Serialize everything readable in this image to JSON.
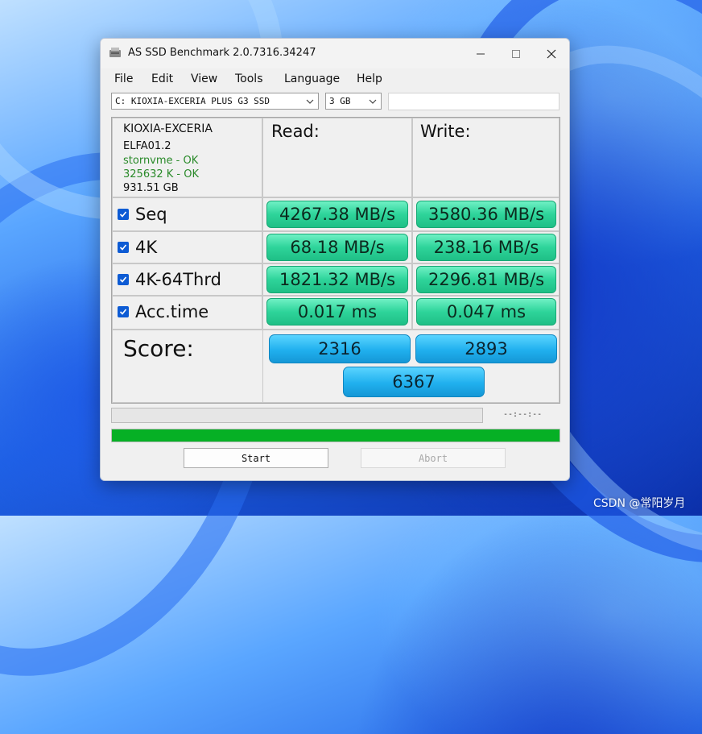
{
  "window": {
    "title": "AS SSD Benchmark 2.0.7316.34247"
  },
  "menu": [
    "File",
    "Edit",
    "View",
    "Tools",
    "Language",
    "Help"
  ],
  "drive_select": {
    "value": "C: KIOXIA-EXCERIA PLUS G3 SSD"
  },
  "size_select": {
    "value": "3 GB"
  },
  "drive_info": {
    "model": "KIOXIA-EXCERIA",
    "firmware": "ELFA01.2",
    "driver": "stornvme - OK",
    "alignment": "325632 K - OK",
    "capacity": "931.51 GB"
  },
  "columns": {
    "read": "Read:",
    "write": "Write:"
  },
  "tests": [
    {
      "label": "Seq",
      "checked": true,
      "read": "4267.38 MB/s",
      "write": "3580.36 MB/s"
    },
    {
      "label": "4K",
      "checked": true,
      "read": "68.18 MB/s",
      "write": "238.16 MB/s"
    },
    {
      "label": "4K-64Thrd",
      "checked": true,
      "read": "1821.32 MB/s",
      "write": "2296.81 MB/s"
    },
    {
      "label": "Acc.time",
      "checked": true,
      "read": "0.017 ms",
      "write": "0.047 ms"
    }
  ],
  "score": {
    "label": "Score:",
    "read": "2316",
    "write": "2893",
    "total": "6367"
  },
  "progress": {
    "time": "--:--:--",
    "overall_fraction": 1.0
  },
  "buttons": {
    "start": "Start",
    "abort": "Abort"
  },
  "watermark": "CSDN @常阳岁月",
  "colors": {
    "value_bar": "#2ed49a",
    "score_bar": "#20b0ee",
    "progress": "#06b025",
    "checkbox": "#0d5bd4",
    "info_ok": "#2a8a2a"
  }
}
